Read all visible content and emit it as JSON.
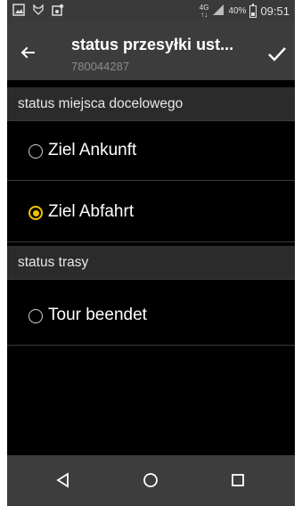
{
  "status_bar": {
    "network": "4G",
    "network_sub": "↑↓",
    "battery": "40%",
    "battery_level": 0.4,
    "time": "09:51",
    "icons": [
      "image-icon",
      "fox-icon",
      "notification-icon"
    ]
  },
  "app_bar": {
    "title": "status przesyłki ust...",
    "subtitle": "780044287",
    "back_icon": "arrow-left-icon",
    "confirm_icon": "check-icon"
  },
  "sections": [
    {
      "header": "status miejsca docelowego",
      "options": [
        {
          "label": "Ziel Ankunft",
          "checked": false
        },
        {
          "label": "Ziel Abfahrt",
          "checked": true
        }
      ]
    },
    {
      "header": "status trasy",
      "options": [
        {
          "label": "Tour beendet",
          "checked": false
        }
      ]
    }
  ],
  "nav": [
    "back-triangle-icon",
    "home-circle-icon",
    "recents-square-icon"
  ],
  "colors": {
    "accent": "#f2c200",
    "appbar": "#3c3c3c",
    "background": "#000000"
  }
}
